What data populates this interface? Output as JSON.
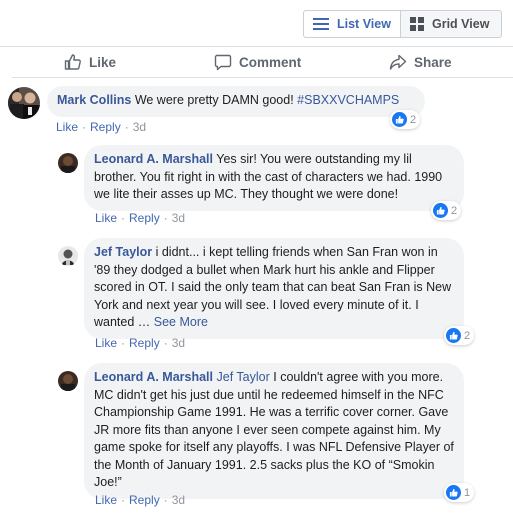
{
  "view_toggle": {
    "list_label": "List View",
    "grid_label": "Grid View"
  },
  "actions": {
    "like": "Like",
    "comment": "Comment",
    "share": "Share"
  },
  "comments": [
    {
      "author": "Mark Collins",
      "mention": "",
      "text": "We were pretty DAMN good!",
      "hashtag": "#SBXXVCHAMPS",
      "like": "Like",
      "reply": "Reply",
      "time": "3d",
      "reaction_count": "2"
    },
    {
      "author": "Leonard A. Marshall",
      "text": "Yes sir! You were outstanding my lil brother. You fit right in with the cast of characters we had. 1990 we lite their asses up MC. They thought we were done!",
      "like": "Like",
      "reply": "Reply",
      "time": "3d",
      "reaction_count": "2"
    },
    {
      "author": "Jef Taylor",
      "text": "i didnt... i kept telling friends when San Fran won in '89 they dodged a bullet when Mark hurt his ankle and Flipper scored in OT. I said the only team that can beat San Fran is New York and next year you will see. I loved every minute of it. I wanted …",
      "see_more": "See More",
      "like": "Like",
      "reply": "Reply",
      "time": "3d",
      "reaction_count": "2"
    },
    {
      "author": "Leonard A. Marshall",
      "mention": "Jef Taylor",
      "text": "I couldn't agree with you more. MC didn't get his just due until he redeemed himself in the NFC Championship Game 1991. He was a terrific cover corner. Gave JR more fits than anyone I ever seen compete against him. My game spoke for itself any playoffs. I was NFL Defensive Player of the Month of January 1991. 2.5 sacks plus the KO of “Smokin Joe!”",
      "like": "Like",
      "reply": "Reply",
      "time": "3d",
      "reaction_count": "1"
    }
  ],
  "colors": {
    "link_blue": "#385898",
    "like_blue": "#1877f2",
    "bubble_bg": "#f2f3f5",
    "meta_gray": "#90949c"
  },
  "icons": [
    "list-icon",
    "grid-icon",
    "thumbs-up-icon",
    "speech-bubble-icon",
    "share-arrow-icon",
    "like-reaction-icon"
  ]
}
